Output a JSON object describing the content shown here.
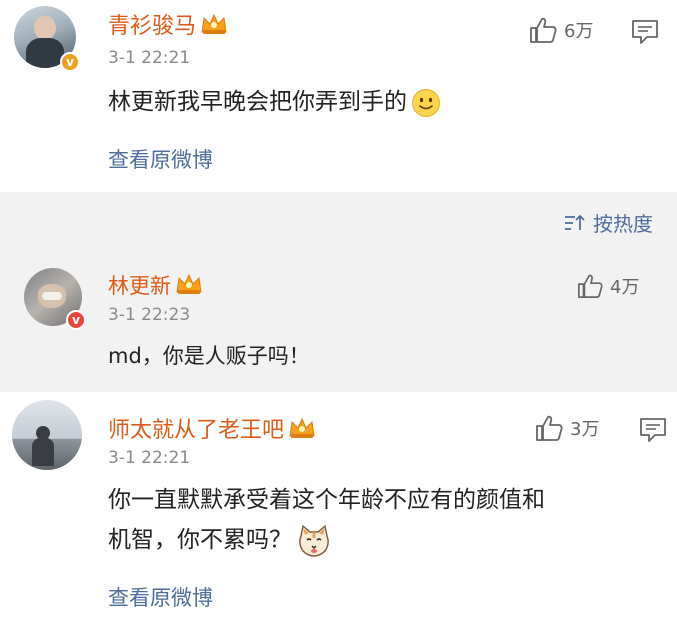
{
  "comment1": {
    "username": "青衫骏马",
    "time": "3-1 22:21",
    "likes": "6万",
    "text": "林更新我早晚会把你弄到手的",
    "emoji": "smile-emoji",
    "view_original": "查看原微博"
  },
  "sort": {
    "label": "按热度"
  },
  "comment2": {
    "username": "林更新",
    "time": "3-1 22:23",
    "likes": "4万",
    "text": "md，你是人贩子吗！"
  },
  "comment3": {
    "username": "师太就从了老王吧",
    "time": "3-1 22:21",
    "likes": "3万",
    "text_line1": "你一直默默承受着这个年龄不应有的颜值和",
    "text_line2": "机智，你不累吗？",
    "emoji": "cat-emoji",
    "view_original": "查看原微博"
  },
  "colors": {
    "username": "#e05a18",
    "link": "#4e6e9c",
    "vip_badge": "#f0a020",
    "verified_badge": "#e8463a"
  }
}
